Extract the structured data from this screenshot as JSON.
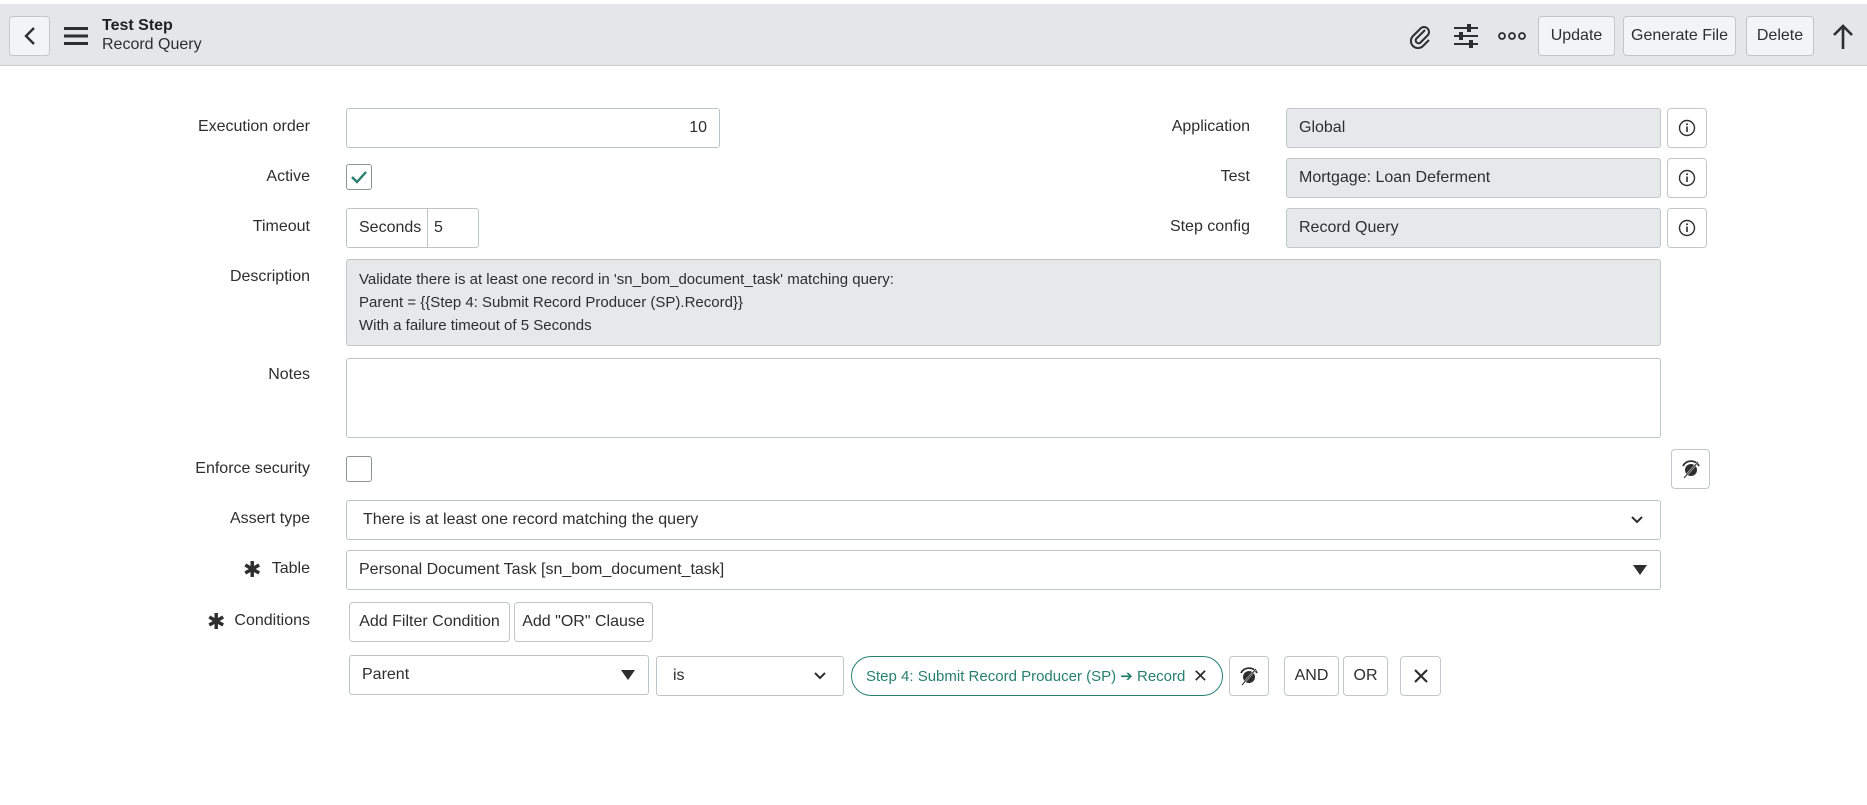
{
  "header": {
    "title": "Test Step",
    "subtitle": "Record Query",
    "update_label": "Update",
    "generate_label": "Generate File",
    "delete_label": "Delete"
  },
  "form": {
    "execution_order": {
      "label": "Execution order",
      "value": "10"
    },
    "active": {
      "label": "Active",
      "checked": true
    },
    "timeout": {
      "label": "Timeout",
      "unit": "Seconds",
      "value": "5"
    },
    "application": {
      "label": "Application",
      "value": "Global"
    },
    "test": {
      "label": "Test",
      "value": "Mortgage: Loan Deferment"
    },
    "step_config": {
      "label": "Step config",
      "value": "Record Query"
    },
    "description": {
      "label": "Description",
      "lines": [
        "Validate there is at least one record in 'sn_bom_document_task' matching query:",
        "Parent = {{Step 4: Submit Record Producer (SP).Record}}",
        "With a failure timeout of 5 Seconds"
      ]
    },
    "notes": {
      "label": "Notes",
      "value": ""
    },
    "enforce_security": {
      "label": "Enforce security",
      "checked": false
    },
    "assert_type": {
      "label": "Assert type",
      "value": "There is at least one record matching the query"
    },
    "table": {
      "label": "Table",
      "value": "Personal Document Task [sn_bom_document_task]"
    },
    "conditions": {
      "label": "Conditions",
      "add_filter_label": "Add Filter Condition",
      "add_or_label": "Add \"OR\" Clause",
      "field": "Parent",
      "operator": "is",
      "value_pill": "Step 4: Submit Record Producer (SP) ➔ Record",
      "and_label": "AND",
      "or_label": "OR"
    }
  },
  "colors": {
    "header_bg": "#e4e6e7",
    "accent": "#27806f",
    "readonly_bg": "#e6e8ea"
  }
}
